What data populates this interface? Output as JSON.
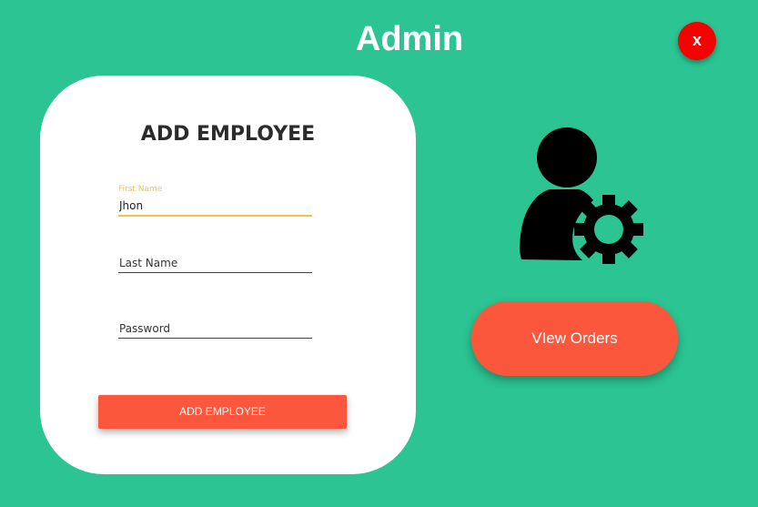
{
  "header": {
    "title": "Admin",
    "close_label": "x"
  },
  "form": {
    "heading": "ADD EMPLOYEE",
    "first_name": {
      "label": "First Name",
      "value": "Jhon"
    },
    "last_name": {
      "placeholder": "Last Name",
      "value": ""
    },
    "password": {
      "placeholder": "Password",
      "value": ""
    },
    "submit_label": "ADD EMPLOYEE"
  },
  "side": {
    "icon": "user-gear-icon",
    "orders_label": "VIew Orders"
  },
  "colors": {
    "background": "#2bc492",
    "accent": "#fb573c",
    "close": "#f70000",
    "focus": "#f3c24a"
  }
}
